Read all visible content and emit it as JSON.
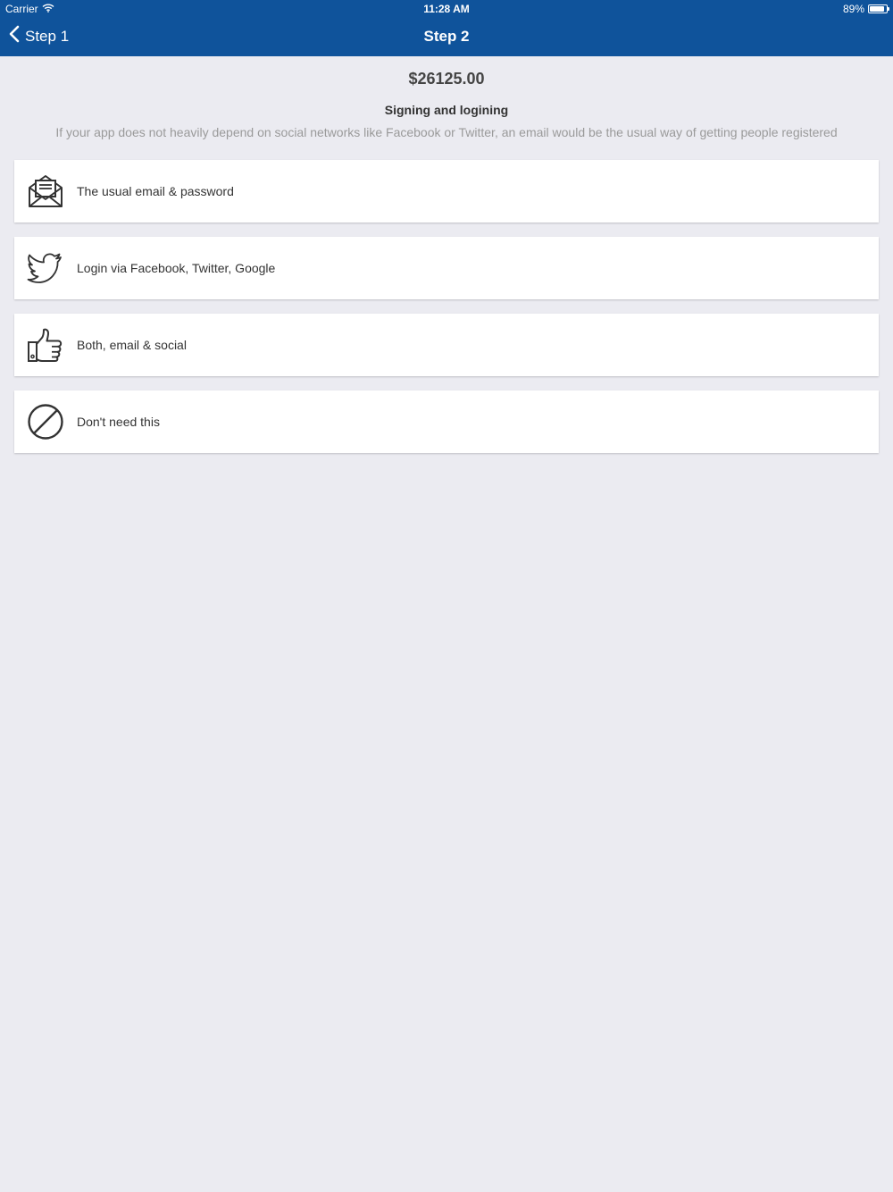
{
  "status_bar": {
    "carrier": "Carrier",
    "time": "11:28 AM",
    "battery": "89%",
    "battery_level": 0.89,
    "wifi_icon": "wifi-icon",
    "battery_icon": "battery-icon"
  },
  "nav": {
    "back_label": "Step 1",
    "back_icon": "chevron-left-icon",
    "title": "Step 2"
  },
  "content": {
    "price": "$26125.00",
    "section_title": "Signing and logining",
    "section_description": "If your app does not heavily depend on social networks like Facebook or Twitter, an email would be the usual way of getting people registered"
  },
  "options": [
    {
      "label": "The usual email & password",
      "icon": "envelope-icon"
    },
    {
      "label": "Login via Facebook, Twitter, Google",
      "icon": "twitter-bird-icon"
    },
    {
      "label": "Both, email & social",
      "icon": "thumbs-up-icon"
    },
    {
      "label": "Don't need this",
      "icon": "prohibited-icon"
    }
  ],
  "colors": {
    "navbar": "#0f539b",
    "background": "#ebebf1",
    "card": "#ffffff",
    "text": "#333333",
    "muted_text": "#9a9a9a"
  }
}
